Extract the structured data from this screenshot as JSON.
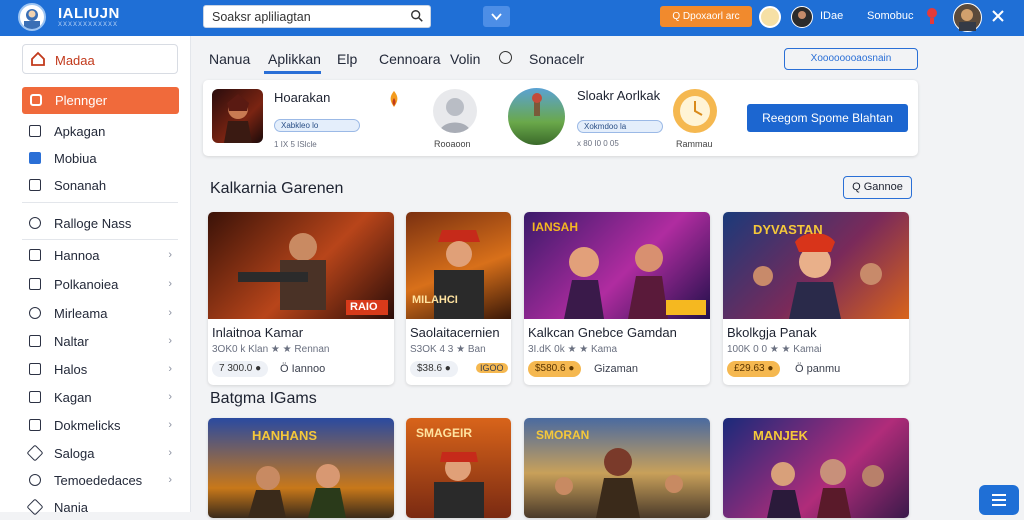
{
  "topbar": {
    "logo_text": "IALIUJN",
    "logo_sub": "XXXXXXXXXXXX",
    "search_placeholder": "Soaksr apliliagtan",
    "cta_label": "Q Dpoxaorl arc",
    "user1_label": "IDae",
    "user2_label": "Somobuc"
  },
  "sidebar": {
    "top": {
      "label": "Madaa"
    },
    "active": {
      "label": "Plennger"
    },
    "items": [
      {
        "label": "Apkagan",
        "chevron": false,
        "blue": false
      },
      {
        "label": "Mobiua",
        "chevron": false,
        "blue": true
      },
      {
        "label": "Sonanah",
        "chevron": false,
        "blue": false
      },
      {
        "label": "Ralloge Nass",
        "chevron": false,
        "blue": false
      },
      {
        "label": "Hannoa",
        "chevron": true,
        "blue": false
      },
      {
        "label": "Polkanoiea",
        "chevron": true,
        "blue": false
      },
      {
        "label": "Mirleama",
        "chevron": true,
        "blue": false
      },
      {
        "label": "Naltar",
        "chevron": true,
        "blue": false
      },
      {
        "label": "Halos",
        "chevron": true,
        "blue": false
      },
      {
        "label": "Kagan",
        "chevron": true,
        "blue": false
      },
      {
        "label": "Dokmelicks",
        "chevron": true,
        "blue": false
      },
      {
        "label": "Saloga",
        "chevron": true,
        "blue": false
      },
      {
        "label": "Temoededaces",
        "chevron": true,
        "blue": false
      },
      {
        "label": "Nania",
        "chevron": false,
        "blue": false
      }
    ]
  },
  "tabs": [
    {
      "label": "Nanua",
      "active": false
    },
    {
      "label": "Aplikkan",
      "active": true
    },
    {
      "label": "Elp",
      "active": false
    },
    {
      "label": "Cennoara",
      "active": false
    },
    {
      "label": "Volin",
      "active": false
    },
    {
      "label": "Sonacelr",
      "active": false
    }
  ],
  "tab_button": "Xoooooooaosnain",
  "featured": {
    "items": [
      {
        "title": "Hoarakan",
        "pill": "Xabkleo lo",
        "meta": "1 IX 5 ISlcle"
      },
      {
        "title": "Sloakr Aorlkak",
        "pill": "Xokmdoo la",
        "meta": "x 80 I0 0 05"
      }
    ],
    "person1_label": "Rooaoon",
    "person2_label": "Rammau",
    "cta": "Reegom Spome Blahtan"
  },
  "section1": {
    "title": "Kalkarnia Garenen",
    "button": "Q Gannoe"
  },
  "section2": {
    "title": "Batgma IGams"
  },
  "games": [
    {
      "title": "Inlaitnoa Kamar",
      "meta": "3OK0 k Klan ★ ★ Rennan",
      "price": "7 300.0 ●",
      "price_style": "gray",
      "extra": "Ö Iannoo",
      "img_text": "RAIO"
    },
    {
      "title": "Saolaitacernien",
      "meta": "S3OK 4 3 ★ Ban",
      "price": "$38.6 ●",
      "price_style": "gray",
      "extra": "IGOO",
      "img_text": "MILAHCI"
    },
    {
      "title": "Kalkcan Gnebce Gamdan",
      "meta": "3I.dK 0k ★ ★ Kama",
      "price": "$580.6 ●",
      "price_style": "orange",
      "extra": "Gizaman",
      "img_text": "IANSAH"
    },
    {
      "title": "Bkolkgja Panak",
      "meta": "100K 0 0 ★ ★ Kamai",
      "price": "£29.63 ●",
      "price_style": "orange",
      "extra": "Ö panmu",
      "img_text": "DYVASTAN"
    }
  ],
  "games2": [
    {
      "img_text": "HANHANS"
    },
    {
      "img_text": "SMAGEIR"
    },
    {
      "img_text": "SMORAN"
    },
    {
      "img_text": "MANJEK"
    }
  ],
  "colors": {
    "primary": "#1f6fd6",
    "accent": "#f06a3b",
    "orange": "#f18a2d"
  }
}
